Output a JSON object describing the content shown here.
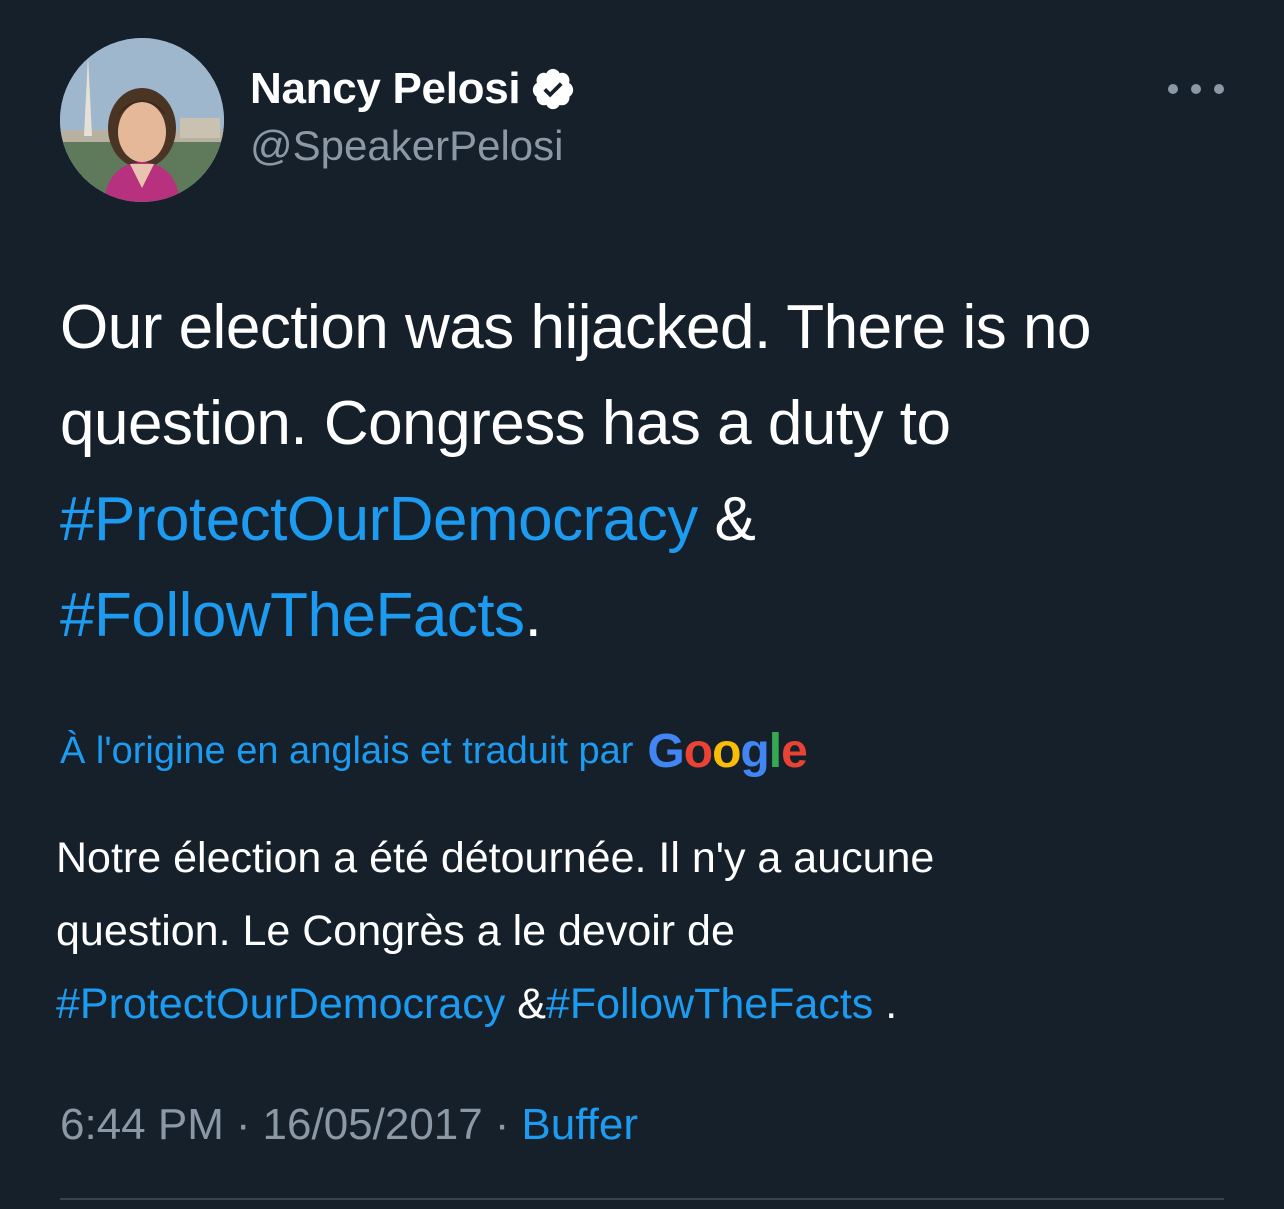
{
  "author": {
    "display_name": "Nancy Pelosi",
    "handle": "@SpeakerPelosi",
    "verified": true,
    "avatar_icon": "profile-avatar"
  },
  "menu": {
    "icon": "more-options-icon"
  },
  "tweet": {
    "line1": "Our election was hijacked. There is no",
    "line2": "question. Congress has a duty to",
    "hashtag1": "#ProtectOurDemocracy",
    "amp": " &",
    "hashtag2": "#FollowTheFacts",
    "end": "."
  },
  "translation": {
    "label": "À l'origine en anglais et traduit par",
    "provider": "Google",
    "line1": "Notre élection a été détournée. Il n'y a aucune",
    "line2": "question. Le Congrès a le devoir de",
    "hashtag1": "#ProtectOurDemocracy",
    "amp": " &",
    "hashtag2": "#FollowTheFacts",
    "end": " ."
  },
  "meta": {
    "time": "6:44 PM",
    "separator": "·",
    "date": "16/05/2017",
    "source": "Buffer"
  },
  "colors": {
    "background": "#15202b",
    "link": "#1d9bf0",
    "secondary_text": "#8b98a5"
  }
}
